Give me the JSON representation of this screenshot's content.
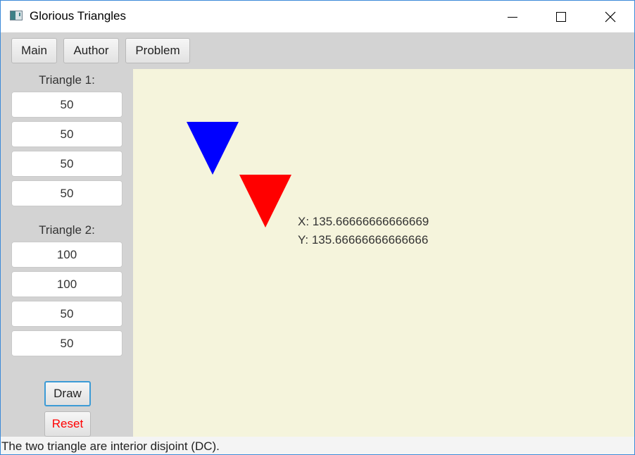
{
  "window": {
    "title": "Glorious Triangles"
  },
  "toolbar": {
    "main_label": "Main",
    "author_label": "Author",
    "problem_label": "Problem"
  },
  "sidebar": {
    "triangle1": {
      "label": "Triangle 1:",
      "fields": [
        "50",
        "50",
        "50",
        "50"
      ]
    },
    "triangle2": {
      "label": "Triangle 2:",
      "fields": [
        "100",
        "100",
        "50",
        "50"
      ]
    },
    "draw_label": "Draw",
    "reset_label": "Reset"
  },
  "canvas": {
    "coord_x": "X: 135.66666666666669",
    "coord_y": "Y: 135.66666666666666",
    "triangle1_color": "#0000ff",
    "triangle2_color": "#ff0000",
    "background_color": "#f5f4dc"
  },
  "status": {
    "text": "The two triangle are interior disjoint (DC)."
  },
  "icons": {
    "app": "app-icon",
    "minimize": "minimize-icon",
    "maximize": "maximize-icon",
    "close": "close-icon"
  }
}
